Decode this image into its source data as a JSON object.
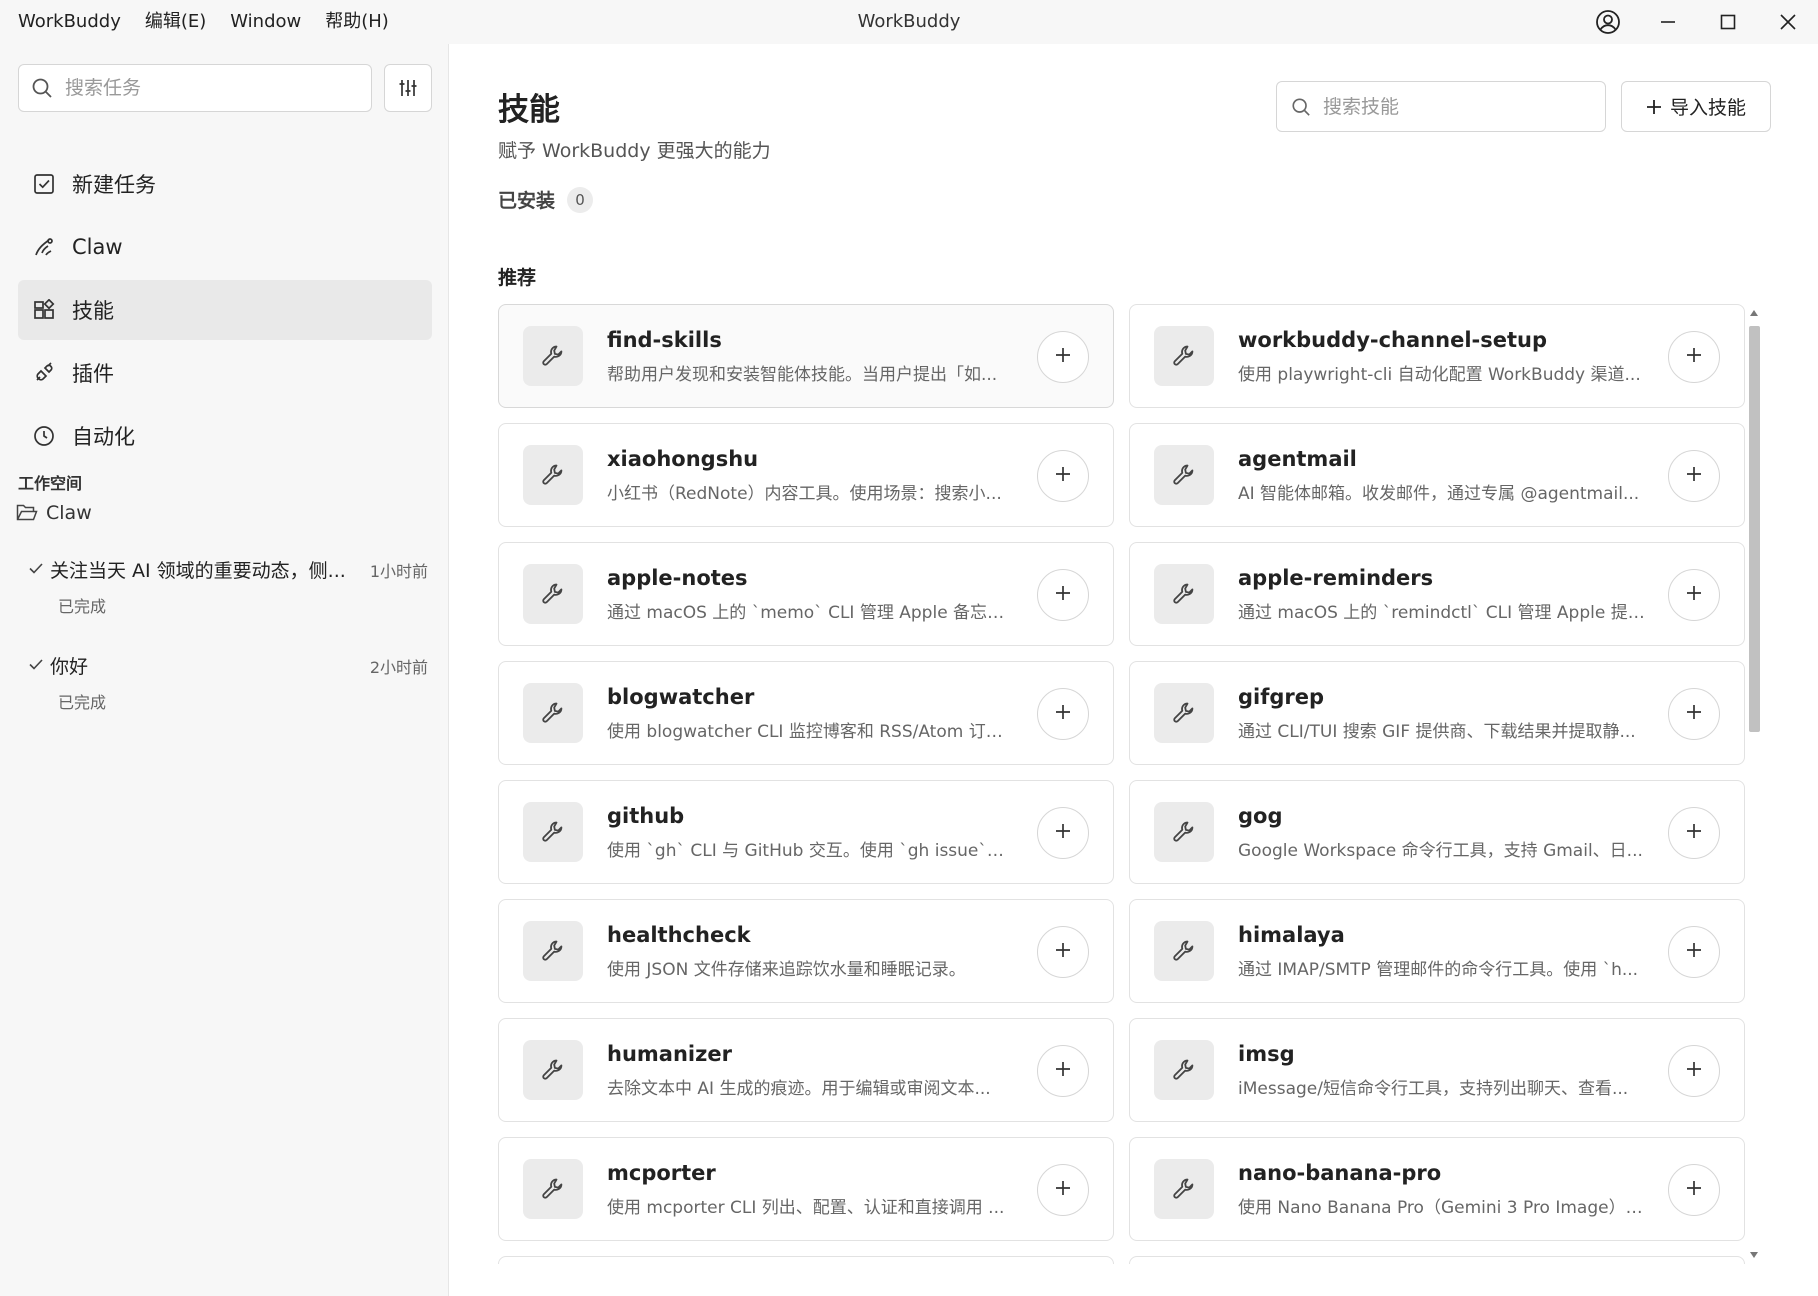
{
  "menu": [
    {
      "label": "WorkBuddy"
    },
    {
      "label": "编辑(E)"
    },
    {
      "label": "Window"
    },
    {
      "label": "帮助(H)"
    }
  ],
  "window_title": "WorkBuddy",
  "sidebar": {
    "search_placeholder": "搜索任务",
    "nav": [
      {
        "label": "新建任务",
        "icon": "checkbox-edit-icon"
      },
      {
        "label": "Claw",
        "icon": "claw-icon"
      },
      {
        "label": "技能",
        "icon": "skills-icon",
        "active": true
      },
      {
        "label": "插件",
        "icon": "plug-icon"
      },
      {
        "label": "自动化",
        "icon": "clock-icon"
      }
    ],
    "workspace_title": "工作空间",
    "workspace_folder": "Claw",
    "tasks": [
      {
        "title": "关注当天 AI 领域的重要动态，侧...",
        "time": "1小时前",
        "status": "已完成"
      },
      {
        "title": "你好",
        "time": "2小时前",
        "status": "已完成"
      }
    ]
  },
  "main": {
    "title": "技能",
    "subtitle": "赋予 WorkBuddy 更强大的能力",
    "installed_label": "已安装",
    "installed_count": "0",
    "search_placeholder": "搜索技能",
    "import_label": "导入技能",
    "recommended_title": "推荐",
    "skills": [
      {
        "name": "find-skills",
        "desc": "帮助用户发现和安装智能体技能。当用户提出「如..."
      },
      {
        "name": "workbuddy-channel-setup",
        "desc": "使用 playwright-cli 自动化配置 WorkBuddy 渠道..."
      },
      {
        "name": "xiaohongshu",
        "desc": "小红书（RedNote）内容工具。使用场景：搜索小..."
      },
      {
        "name": "agentmail",
        "desc": "AI 智能体邮箱。收发邮件，通过专属 @agentmail..."
      },
      {
        "name": "apple-notes",
        "desc": "通过 macOS 上的 `memo` CLI 管理 Apple 备忘录..."
      },
      {
        "name": "apple-reminders",
        "desc": "通过 macOS 上的 `remindctl` CLI 管理 Apple 提醒..."
      },
      {
        "name": "blogwatcher",
        "desc": "使用 blogwatcher CLI 监控博客和 RSS/Atom 订阅..."
      },
      {
        "name": "gifgrep",
        "desc": "通过 CLI/TUI 搜索 GIF 提供商、下载结果并提取静..."
      },
      {
        "name": "github",
        "desc": "使用 `gh` CLI 与 GitHub 交互。使用 `gh issue`、`..."
      },
      {
        "name": "gog",
        "desc": "Google Workspace 命令行工具，支持 Gmail、日..."
      },
      {
        "name": "healthcheck",
        "desc": "使用 JSON 文件存储来追踪饮水量和睡眠记录。"
      },
      {
        "name": "himalaya",
        "desc": "通过 IMAP/SMTP 管理邮件的命令行工具。使用 `h..."
      },
      {
        "name": "humanizer",
        "desc": "去除文本中 AI 生成的痕迹。用于编辑或审阅文本..."
      },
      {
        "name": "imsg",
        "desc": "iMessage/短信命令行工具，支持列出聊天、查看..."
      },
      {
        "name": "mcporter",
        "desc": "使用 mcporter CLI 列出、配置、认证和直接调用 ..."
      },
      {
        "name": "nano-banana-pro",
        "desc": "使用 Nano Banana Pro（Gemini 3 Pro Image）生..."
      },
      {
        "name": "",
        "desc": ""
      },
      {
        "name": "",
        "desc": ""
      }
    ]
  }
}
